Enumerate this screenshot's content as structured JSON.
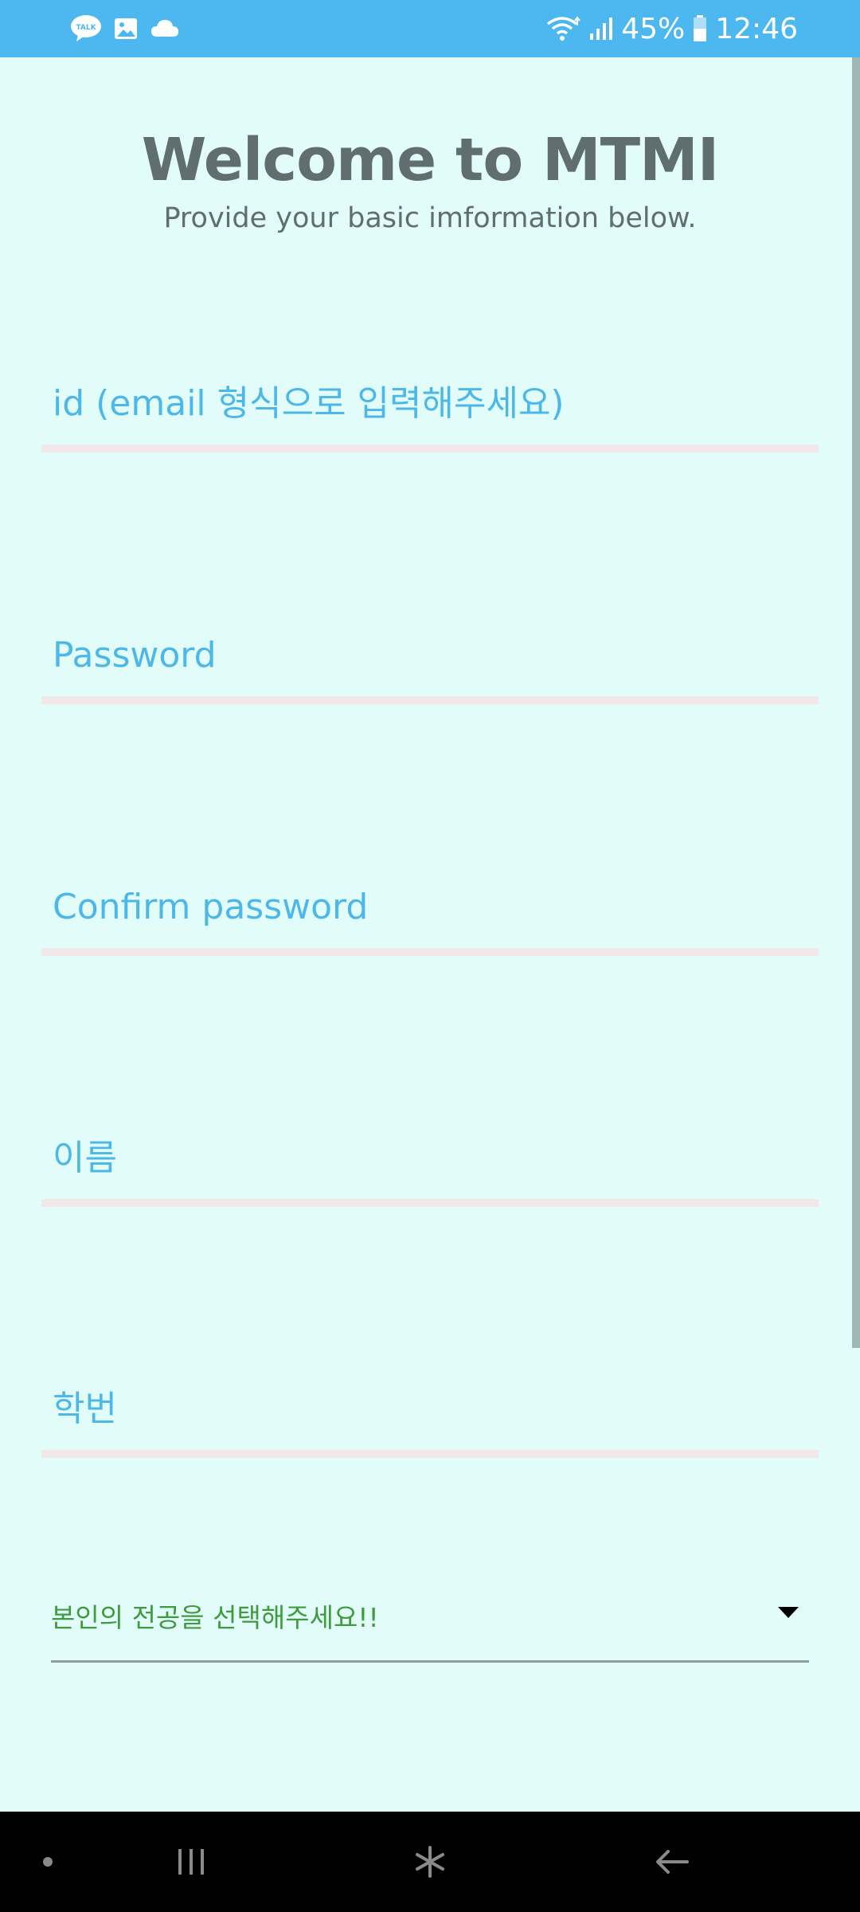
{
  "status_bar": {
    "battery": "45%",
    "time": "12:46",
    "kakao_icon_text": "TALK",
    "background_color": "#4DB8F0"
  },
  "header": {
    "title": "Welcome to MTMI",
    "subtitle": "Provide your basic imformation below."
  },
  "form": {
    "id_placeholder": "id (email 형식으로 입력해주세요)",
    "password_placeholder": "Password",
    "confirm_password_placeholder": "Confirm password",
    "name_placeholder": "이름",
    "student_id_placeholder": "학번",
    "major_select_value": "본인의 전공을 선택해주세요!!"
  },
  "nav_bar": {
    "icons": [
      "dot-icon",
      "recent-apps-icon",
      "home-icon",
      "back-icon"
    ]
  },
  "colors": {
    "background": "#E1FCF9",
    "title": "#616E70",
    "placeholder": "#4DB8E8",
    "select_text": "#3E9B3E",
    "underline": "#F2E8EA"
  }
}
